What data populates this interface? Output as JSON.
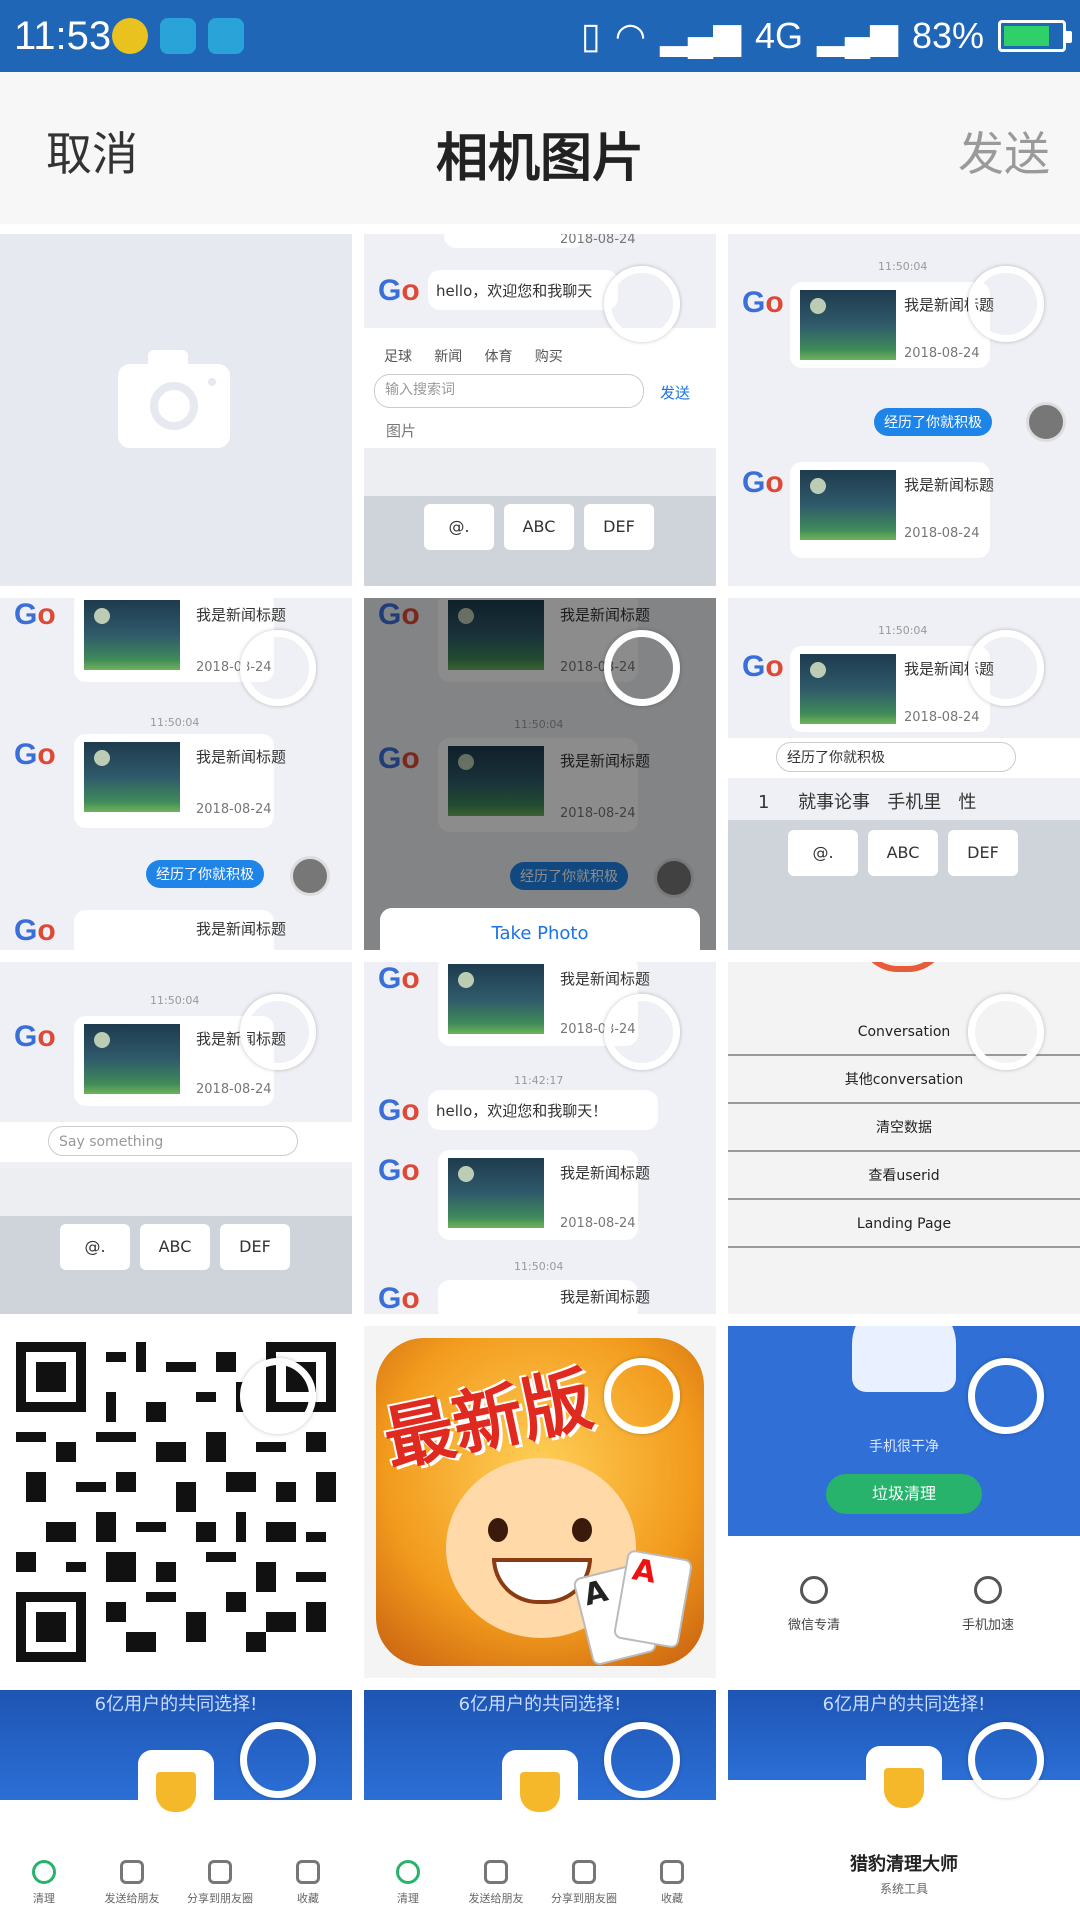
{
  "status_bar": {
    "time": "11:53",
    "network": "4G",
    "battery": "83%",
    "battery_level": 0.83,
    "colors": {
      "background": "#1f66b6",
      "battery_fill": "#2fd06a"
    }
  },
  "header": {
    "cancel_label": "取消",
    "title": "相机图片",
    "send_label": "发送"
  },
  "tiles": {
    "t2": {
      "date_top": "2018-08-24",
      "greeting": "hello，欢迎您和我聊天",
      "tabs": [
        "足球",
        "新闻",
        "体育",
        "购买"
      ],
      "input_placeholder": "输入搜索词",
      "send": "发送",
      "photo_label": "图片",
      "keys": [
        "@.",
        "ABC",
        "DEF"
      ]
    },
    "t3": {
      "time": "11:50:04",
      "news_title": "我是新闻标题",
      "date": "2018-08-24",
      "blue_message": "经历了你就积极"
    },
    "t4": {
      "news_title": "我是新闻标题",
      "date": "2018-08-24",
      "time": "11:50:04",
      "blue_message": "经历了你就积极"
    },
    "t5": {
      "news_title": "我是新闻标题",
      "date": "2018-08-24",
      "time": "11:50:04",
      "blue_message": "经历了你就积极",
      "sheet_button": "Take Photo"
    },
    "t6": {
      "time": "11:50:04",
      "news_title": "我是新闻标题",
      "date": "2018-08-24",
      "input_text": "经历了你就积极",
      "suggestions": [
        "1",
        "就事论事",
        "手机里",
        "性"
      ],
      "keys": [
        "@.",
        "ABC",
        "DEF"
      ]
    },
    "t7": {
      "time": "11:50:04",
      "news_title": "我是新闻标题",
      "date": "2018-08-24",
      "input_placeholder": "Say something",
      "keys": [
        "@.",
        "ABC",
        "DEF"
      ]
    },
    "t8": {
      "news_title": "我是新闻标题",
      "date": "2018-08-24",
      "time": "11:42:17",
      "greeting": "hello，欢迎您和我聊天！",
      "time2": "11:50:04"
    },
    "t9": {
      "items": [
        "Conversation",
        "其他conversation",
        "清空数据",
        "查看userid",
        "Landing Page"
      ]
    },
    "t11": {
      "banner": "最新版"
    },
    "t12": {
      "status_text": "手机很干净",
      "button": "垃圾清理",
      "options": [
        "微信专清",
        "手机加速"
      ]
    },
    "t13": {
      "slogan": "6亿用户的共同选择!",
      "nav": [
        "清理",
        "发送给朋友",
        "分享到朋友圈",
        "收藏"
      ]
    },
    "t14": {
      "slogan": "6亿用户的共同选择!",
      "nav": [
        "清理",
        "发送给朋友",
        "分享到朋友圈",
        "收藏"
      ]
    },
    "t15": {
      "slogan": "6亿用户的共同选择!",
      "app_name": "猎豹清理大师",
      "app_sub": "系统工具"
    }
  }
}
